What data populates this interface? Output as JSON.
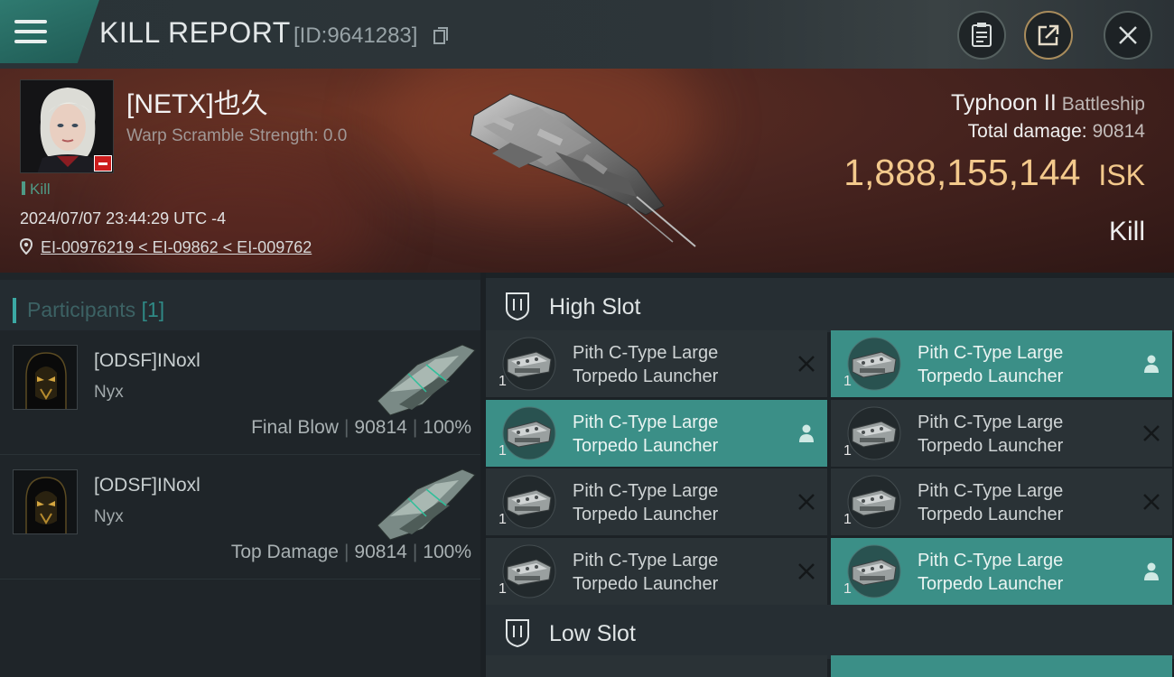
{
  "topbar": {
    "title": "KILL REPORT",
    "report_id": "[ID:9641283]",
    "icons": [
      "menu-icon",
      "copy-icon",
      "clipboard-icon",
      "share-icon",
      "close-icon"
    ]
  },
  "victim": {
    "name": "[NETX]也久",
    "warp_scramble": "Warp Scramble Strength: 0.0",
    "tag": "Kill",
    "time": "2024/07/07 23:44:29 UTC -4",
    "location": "EI-00976219 < EI-09862 < EI-009762"
  },
  "ship": {
    "name": "Typhoon II",
    "class": "Battleship",
    "total_damage_label": "Total damage:",
    "total_damage": "90814",
    "isk_value": "1,888,155,144",
    "isk_unit": "ISK",
    "outcome": "Kill"
  },
  "participants": {
    "label": "Participants",
    "count": "[1]",
    "items": [
      {
        "name": "[ODSF]INoxl",
        "ship": "Nyx",
        "role": "Final Blow",
        "damage": "90814",
        "percent": "100%"
      },
      {
        "name": "[ODSF]INoxl",
        "ship": "Nyx",
        "role": "Top Damage",
        "damage": "90814",
        "percent": "100%"
      }
    ]
  },
  "high_slot": {
    "label": "High Slot",
    "modules": [
      {
        "name_line1": "Pith C-Type Large",
        "name_line2": "Torpedo Launcher",
        "qty": "1",
        "state": "destroyed"
      },
      {
        "name_line1": "Pith C-Type Large",
        "name_line2": "Torpedo Launcher",
        "qty": "1",
        "state": "dropped"
      },
      {
        "name_line1": "Pith C-Type Large",
        "name_line2": "Torpedo Launcher",
        "qty": "1",
        "state": "dropped"
      },
      {
        "name_line1": "Pith C-Type Large",
        "name_line2": "Torpedo Launcher",
        "qty": "1",
        "state": "destroyed"
      },
      {
        "name_line1": "Pith C-Type Large",
        "name_line2": "Torpedo Launcher",
        "qty": "1",
        "state": "destroyed"
      },
      {
        "name_line1": "Pith C-Type Large",
        "name_line2": "Torpedo Launcher",
        "qty": "1",
        "state": "destroyed"
      },
      {
        "name_line1": "Pith C-Type Large",
        "name_line2": "Torpedo Launcher",
        "qty": "1",
        "state": "destroyed"
      },
      {
        "name_line1": "Pith C-Type Large",
        "name_line2": "Torpedo Launcher",
        "qty": "1",
        "state": "dropped"
      }
    ]
  },
  "low_slot": {
    "label": "Low Slot"
  },
  "colors": {
    "accent_teal": "#3b8f87",
    "isk_gold": "#f3c98c",
    "header_red": "#4a2520"
  }
}
